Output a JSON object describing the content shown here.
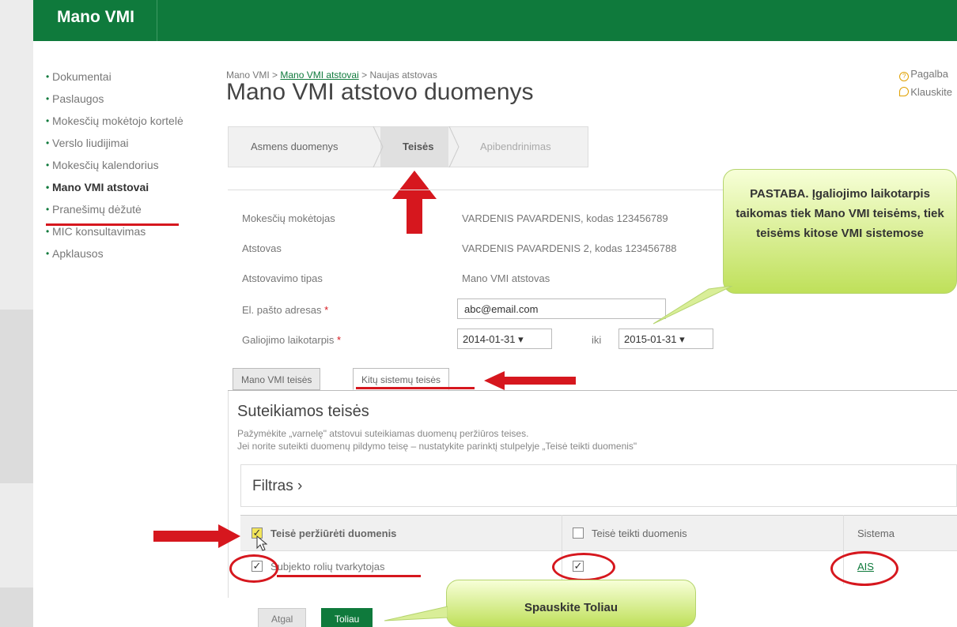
{
  "header": {
    "logo": "Mano VMI"
  },
  "sidebar": {
    "items": [
      {
        "label": "Dokumentai"
      },
      {
        "label": "Paslaugos"
      },
      {
        "label": "Mokesčių mokėtojo kortelė"
      },
      {
        "label": "Verslo liudijimai"
      },
      {
        "label": "Mokesčių kalendorius"
      },
      {
        "label": "Mano VMI atstovai"
      },
      {
        "label": "Pranešimų dėžutė"
      },
      {
        "label": "MIC konsultavimas"
      },
      {
        "label": "Apklausos"
      }
    ]
  },
  "breadcrumb": {
    "root": "Mano VMI",
    "sep": " > ",
    "middle": "Mano VMI atstovai",
    "current": "Naujas atstovas"
  },
  "page_title": "Mano VMI atstovo duomenys",
  "help": {
    "help_label": "Pagalba",
    "ask_label": "Klauskite"
  },
  "steps": [
    {
      "label": "Asmens duomenys"
    },
    {
      "label": "Teisės"
    },
    {
      "label": "Apibendrinimas"
    }
  ],
  "form": {
    "taxpayer_label": "Mokesčių mokėtojas",
    "taxpayer_value": "VARDENIS PAVARDENIS, kodas 123456789",
    "rep_label": "Atstovas",
    "rep_value": "VARDENIS PAVARDENIS 2, kodas 123456788",
    "type_label": "Atstovavimo tipas",
    "type_value": "Mano VMI atstovas",
    "email_label": "El. pašto adresas",
    "email_value": "abc@email.com",
    "period_label": "Galiojimo laikotarpis",
    "date_from": "2014-01-31",
    "to_label": "iki",
    "date_to": "2015-01-31",
    "required_mark": "*"
  },
  "tabs": [
    {
      "label": "Mano VMI teisės"
    },
    {
      "label": "Kitų sistemų teisės"
    }
  ],
  "section": {
    "title": "Suteikiamos teisės",
    "hint1": "Pažymėkite „varnelę\" atstovui suteikiamas duomenų peržiūros teises.",
    "hint2": "Jei norite suteikti duomenų pildymo teisę – nustatykite parinktį stulpelyje „Teisė teikti duomenis\""
  },
  "filter": {
    "label": "Filtras ›"
  },
  "table": {
    "columns": [
      "Teisė peržiūrėti duomenis",
      "Teisė teikti duomenis",
      "Sistema"
    ],
    "rows": [
      {
        "role": "Subjekto rolių tvarkytojas",
        "system": "AIS"
      }
    ]
  },
  "buttons": {
    "back": "Atgal",
    "next": "Toliau"
  },
  "annotations": {
    "note": "PASTABA. Įgaliojimo laikotarpis taikomas tiek Mano VMI teisėms, tiek teisėms kitose VMI sistemose",
    "next_hint": "Spauskite Toliau"
  },
  "colors": {
    "brand": "#0f7a3c",
    "annotation": "#d6171e",
    "callout": "#bfe05a"
  }
}
